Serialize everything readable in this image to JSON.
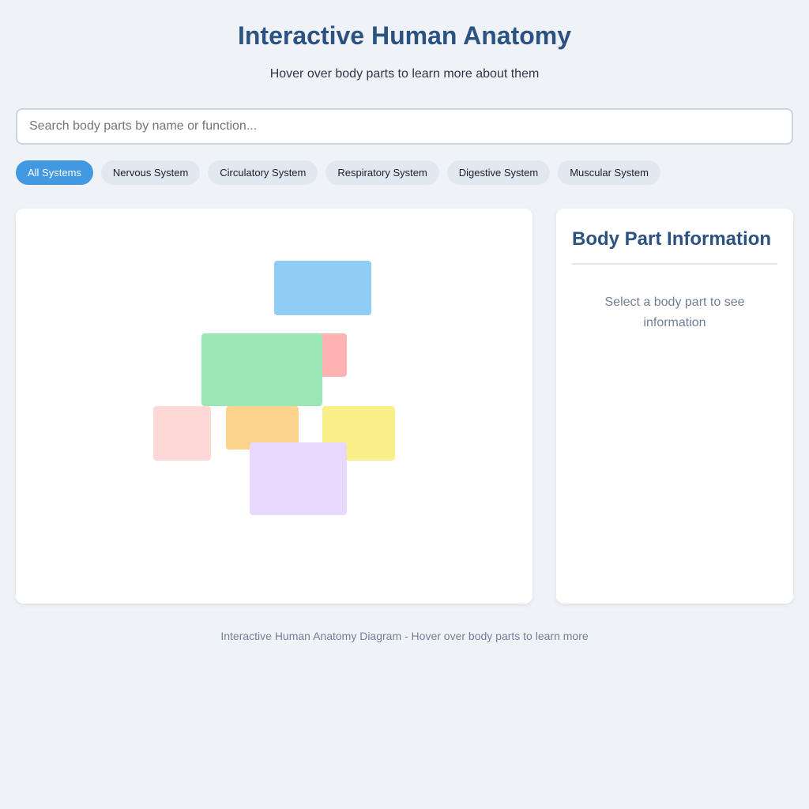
{
  "header": {
    "title": "Interactive Human Anatomy",
    "subtitle": "Hover over body parts to learn more about them"
  },
  "search": {
    "placeholder": "Search body parts by name or function...",
    "value": ""
  },
  "filters": [
    {
      "label": "All Systems",
      "active": true
    },
    {
      "label": "Nervous System",
      "active": false
    },
    {
      "label": "Circulatory System",
      "active": false
    },
    {
      "label": "Respiratory System",
      "active": false
    },
    {
      "label": "Digestive System",
      "active": false
    },
    {
      "label": "Muscular System",
      "active": false
    }
  ],
  "diagram": {
    "parts": [
      {
        "color": "#90cdf4"
      },
      {
        "color": "#feb2b2"
      },
      {
        "color": "#9ae6b4"
      },
      {
        "color": "#fed7d7"
      },
      {
        "color": "#fbd38d"
      },
      {
        "color": "#faf089"
      },
      {
        "color": "#e9d8fd"
      }
    ]
  },
  "info": {
    "title": "Body Part Information",
    "placeholder": "Select a body part to see information"
  },
  "footer": {
    "text": "Interactive Human Anatomy Diagram - Hover over body parts to learn more"
  },
  "colors": {
    "accent": "#4299e1",
    "heading": "#2c5282",
    "background": "#eff3f8"
  }
}
